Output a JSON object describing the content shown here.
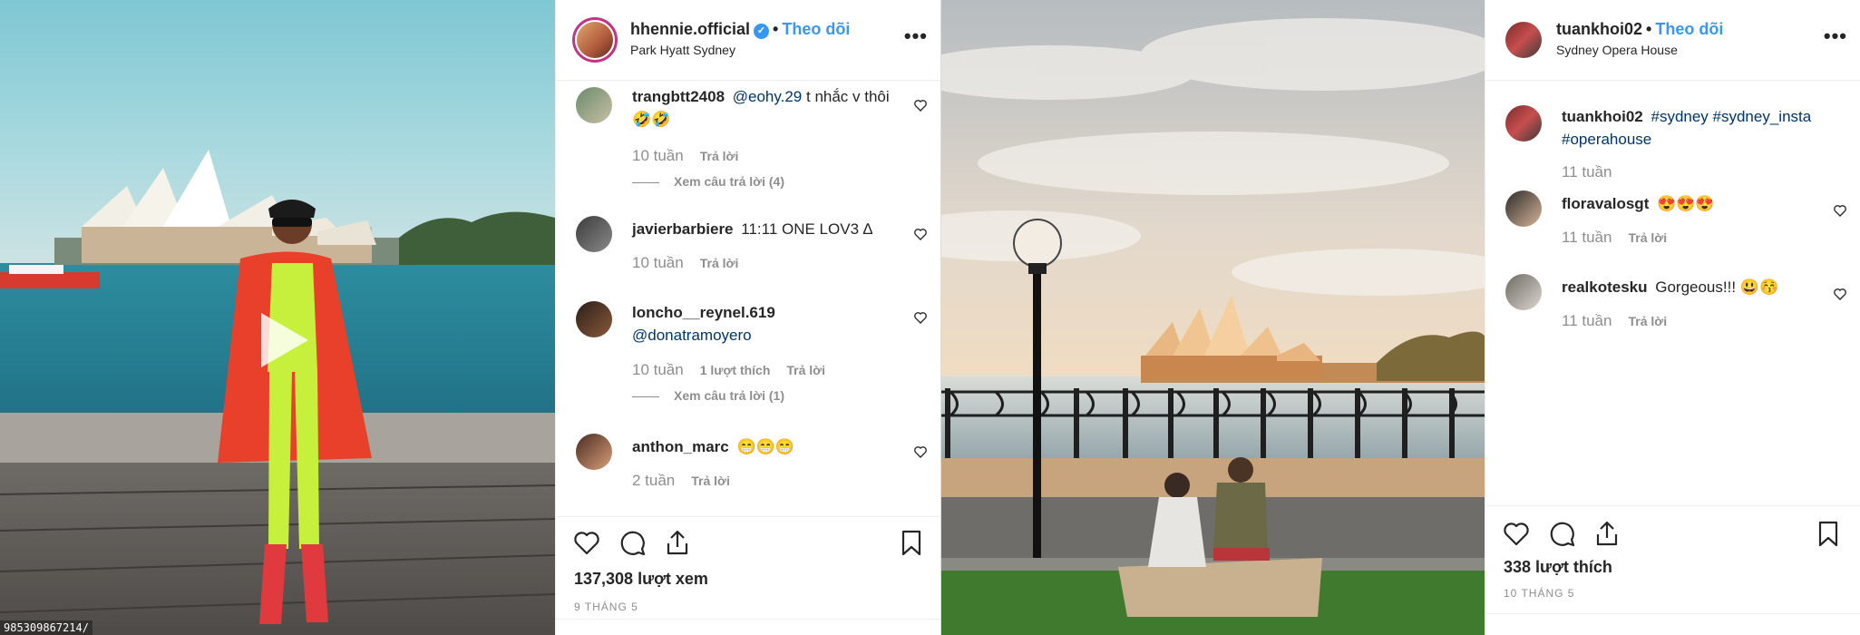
{
  "post1": {
    "username": "hhennie.official",
    "verified_mark": "✓",
    "dot": "•",
    "follow_label": "Theo dõi",
    "location": "Park Hyatt Sydney",
    "more_label": "•••",
    "media_overlay_text": "985309867214/",
    "comments": [
      {
        "user": "trangbtt2408",
        "mention": "@eohy.29",
        "text": "t nhắc v thôi 🤣🤣",
        "age": "10 tuần",
        "reply": "Trả lời",
        "view_replies": "Xem câu trả lời (4)"
      },
      {
        "user": "javierbarbiere",
        "text": "11:11 ONE LOV3 ∆",
        "age": "10 tuần",
        "reply": "Trả lời"
      },
      {
        "user": "loncho__reynel.619",
        "mention": "@donatramoyero",
        "age": "10 tuần",
        "likes": "1 lượt thích",
        "reply": "Trả lời",
        "view_replies": "Xem câu trả lời (1)"
      },
      {
        "user": "anthon_marc",
        "text": "😁😁😁",
        "age": "2 tuần",
        "reply": "Trả lời"
      }
    ],
    "views": "137,308 lượt xem",
    "date": "9 THÁNG 5",
    "icons": [
      "heart-icon",
      "comment-icon",
      "share-icon",
      "bookmark-icon",
      "play-icon"
    ]
  },
  "post2": {
    "username": "tuankhoi02",
    "dot": "•",
    "follow_label": "Theo dõi",
    "location": "Sydney Opera House",
    "more_label": "•••",
    "caption": {
      "user": "tuankhoi02",
      "hashtags": "#sydney #sydney_insta #operahouse",
      "age": "11 tuần"
    },
    "comments": [
      {
        "user": "floravalosgt",
        "text": "😍😍😍",
        "age": "11 tuần",
        "reply": "Trả lời"
      },
      {
        "user": "realkotesku",
        "text": "Gorgeous!!! 😃😚",
        "age": "11 tuần",
        "reply": "Trả lời"
      }
    ],
    "likes": "338 lượt thích",
    "date": "10 THÁNG 5",
    "icons": [
      "heart-icon",
      "comment-icon",
      "share-icon",
      "bookmark-icon"
    ]
  },
  "colors": {
    "link": "#3897f0",
    "muted": "#8e8e8e",
    "text": "#262626",
    "coat": "#e8402a",
    "neon": "#c6f03c"
  }
}
